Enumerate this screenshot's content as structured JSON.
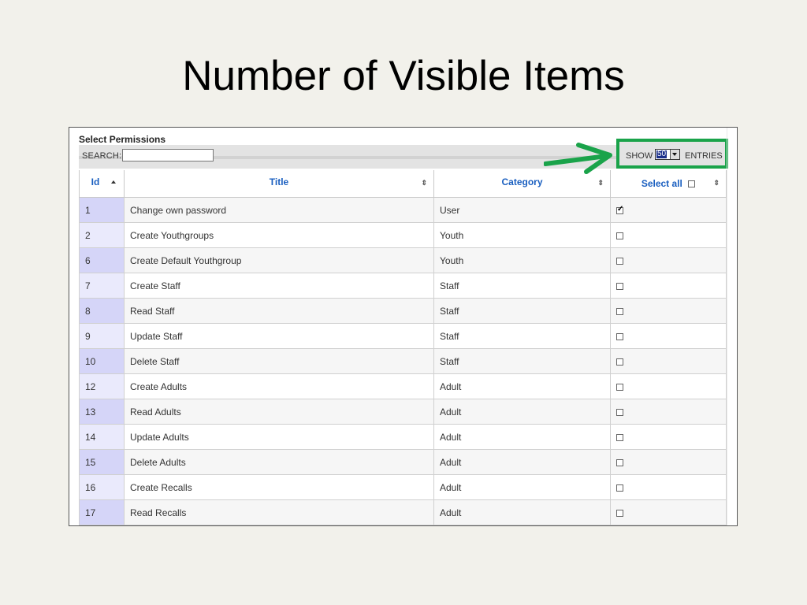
{
  "slide": {
    "title": "Number of Visible Items"
  },
  "panel": {
    "title": "Select Permissions"
  },
  "search": {
    "label": "SEARCH:",
    "value": "",
    "placeholder": ""
  },
  "length": {
    "show_label": "SHOW",
    "selected": "50",
    "entries_label": "ENTRIES"
  },
  "columns": {
    "id": "Id",
    "title": "Title",
    "category": "Category",
    "select_all": "Select all"
  },
  "colors": {
    "highlight_box": "#1aa34a",
    "header_text": "#1a5fc0",
    "id_cell": "#d5d5f8"
  },
  "rows": [
    {
      "id": "1",
      "title": "Change own password",
      "category": "User",
      "checked": true
    },
    {
      "id": "2",
      "title": "Create Youthgroups",
      "category": "Youth",
      "checked": false
    },
    {
      "id": "6",
      "title": "Create Default Youthgroup",
      "category": "Youth",
      "checked": false
    },
    {
      "id": "7",
      "title": "Create Staff",
      "category": "Staff",
      "checked": false
    },
    {
      "id": "8",
      "title": "Read Staff",
      "category": "Staff",
      "checked": false
    },
    {
      "id": "9",
      "title": "Update Staff",
      "category": "Staff",
      "checked": false
    },
    {
      "id": "10",
      "title": "Delete Staff",
      "category": "Staff",
      "checked": false
    },
    {
      "id": "12",
      "title": "Create Adults",
      "category": "Adult",
      "checked": false
    },
    {
      "id": "13",
      "title": "Read Adults",
      "category": "Adult",
      "checked": false
    },
    {
      "id": "14",
      "title": "Update Adults",
      "category": "Adult",
      "checked": false
    },
    {
      "id": "15",
      "title": "Delete Adults",
      "category": "Adult",
      "checked": false
    },
    {
      "id": "16",
      "title": "Create Recalls",
      "category": "Adult",
      "checked": false
    },
    {
      "id": "17",
      "title": "Read Recalls",
      "category": "Adult",
      "checked": false
    }
  ]
}
